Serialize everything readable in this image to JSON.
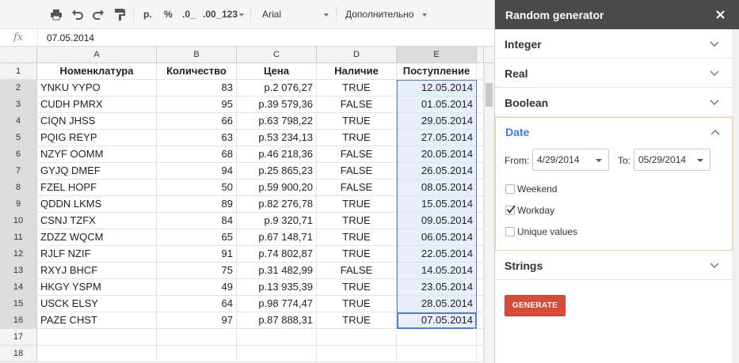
{
  "toolbar": {
    "format_p": "р.",
    "format_percent": "%",
    "format_dec_less": ".0_",
    "format_dec_more": ".00_",
    "format_more": "123",
    "font": "Arial",
    "more": "Дополнительно"
  },
  "formula_bar": {
    "fx": "fx",
    "value": "07.05.2014"
  },
  "grid": {
    "columns": [
      "A",
      "B",
      "C",
      "D",
      "E"
    ],
    "headers": [
      "Номенклатура",
      "Количество",
      "Цена",
      "Наличие",
      "Поступление"
    ],
    "row_numbers": [
      "1",
      "2",
      "3",
      "4",
      "5",
      "6",
      "7",
      "8",
      "9",
      "10",
      "11",
      "12",
      "13",
      "14",
      "15",
      "16",
      "17",
      "18"
    ],
    "rows": [
      [
        "YNKU YYPO",
        "83",
        "р.2 076,27",
        "TRUE",
        "12.05.2014"
      ],
      [
        "CUDH PMRX",
        "95",
        "р.39 579,36",
        "FALSE",
        "01.05.2014"
      ],
      [
        "CIQN JHSS",
        "66",
        "р.63 798,22",
        "TRUE",
        "29.05.2014"
      ],
      [
        "PQIG REYP",
        "63",
        "р.53 234,13",
        "TRUE",
        "27.05.2014"
      ],
      [
        "NZYF OOMM",
        "68",
        "р.46 218,36",
        "FALSE",
        "20.05.2014"
      ],
      [
        "GYJQ DMEF",
        "94",
        "р.25 865,23",
        "FALSE",
        "26.05.2014"
      ],
      [
        "FZEL HOPF",
        "50",
        "р.59 900,20",
        "FALSE",
        "08.05.2014"
      ],
      [
        "QDDN LKMS",
        "89",
        "р.82 276,78",
        "TRUE",
        "15.05.2014"
      ],
      [
        "CSNJ TZFX",
        "84",
        "р.9 320,71",
        "TRUE",
        "09.05.2014"
      ],
      [
        "ZDZZ WQCM",
        "65",
        "р.67 148,71",
        "TRUE",
        "06.05.2014"
      ],
      [
        "RJLF NZIF",
        "91",
        "р.74 802,87",
        "TRUE",
        "22.05.2014"
      ],
      [
        "RXYJ BHCF",
        "75",
        "р.31 482,99",
        "FALSE",
        "14.05.2014"
      ],
      [
        "HKGY YSPM",
        "49",
        "р.13 935,39",
        "TRUE",
        "23.05.2014"
      ],
      [
        "USCK ELSY",
        "64",
        "р.98 774,47",
        "TRUE",
        "28.05.2014"
      ],
      [
        "PAZE CHST",
        "97",
        "р.87 888,31",
        "TRUE",
        "07.05.2014"
      ]
    ]
  },
  "sidebar": {
    "title": "Random generator",
    "sections": [
      "Integer",
      "Real",
      "Boolean"
    ],
    "date": {
      "label": "Date",
      "from_label": "From:",
      "from_value": "4/29/2014",
      "to_label": "To:",
      "to_value": "05/29/2014",
      "options": [
        {
          "label": "Weekend",
          "checked": false
        },
        {
          "label": "Workday",
          "checked": true
        },
        {
          "label": "Unique values",
          "checked": false
        }
      ]
    },
    "strings_label": "Strings",
    "generate_label": "GENERATE"
  },
  "colors": {
    "accent": "#3b7de0",
    "generate": "#d84b36",
    "selection": "#4d7ee5",
    "sidebar_header": "#4a4a4a"
  }
}
